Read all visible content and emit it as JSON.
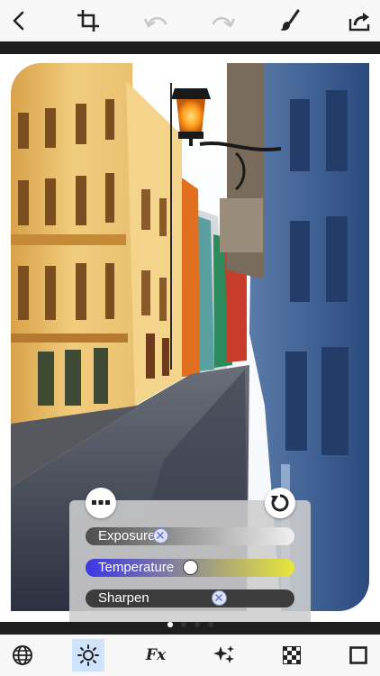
{
  "toolbar": {
    "icons": [
      "back-icon",
      "crop-icon",
      "undo-icon",
      "redo-icon",
      "brush-icon",
      "share-icon"
    ],
    "disabled_color": "#c8c8c8",
    "icon_color": "#222222"
  },
  "photo": {
    "description_icon": "street-photo",
    "sky_color": "#ffffff"
  },
  "adjust_panel": {
    "menu_icon": "more-dots-icon",
    "reset_icon": "reset-icon",
    "sliders": [
      {
        "label": "Exposure",
        "value": 0.35,
        "fill_start": "#4d4d4d",
        "fill_end": "#f0f0f0"
      },
      {
        "label": "Temperature",
        "value": 0.5,
        "fill_start": "#3a36e6",
        "fill_end": "#e8e63a"
      },
      {
        "label": "Sharpen",
        "value": 0.65,
        "fill_start": "#3c3c3c",
        "fill_end": "#3c3c3c"
      }
    ]
  },
  "pager": {
    "count": 4,
    "active": 0
  },
  "bottom_toolbar": {
    "items": [
      "globe-icon",
      "sun-icon",
      "fx-icon",
      "sparkles-icon",
      "checkerboard-icon",
      "square-frame-icon"
    ],
    "active_index": 1,
    "fx_label": "Fx",
    "active_color": "#cfe3fa"
  }
}
